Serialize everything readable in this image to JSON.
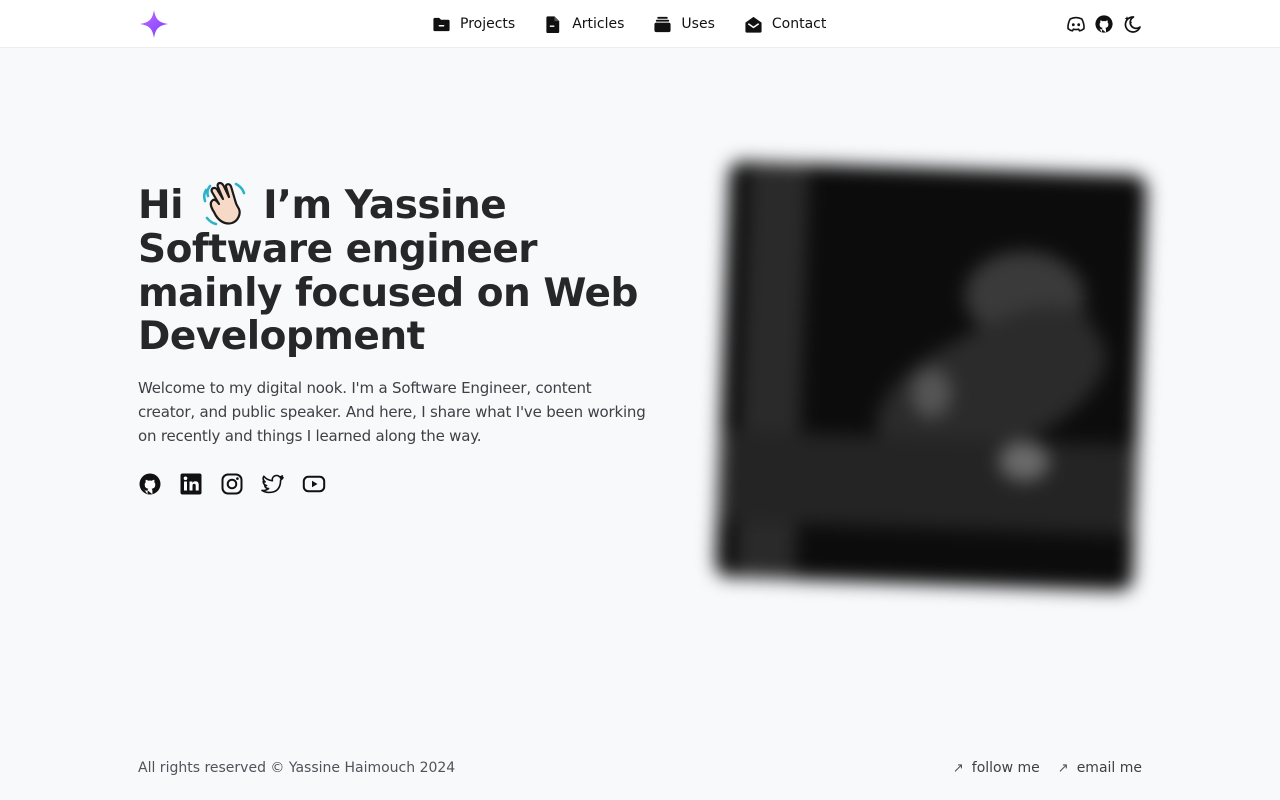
{
  "nav": {
    "items": [
      {
        "label": "Projects",
        "icon": "folder-icon"
      },
      {
        "label": "Articles",
        "icon": "file-icon"
      },
      {
        "label": "Uses",
        "icon": "layers-icon"
      },
      {
        "label": "Contact",
        "icon": "mail-open-icon"
      }
    ]
  },
  "header_icons": [
    "discord-icon",
    "github-icon",
    "theme-toggle-icon"
  ],
  "hero": {
    "title_parts": {
      "hi": "Hi",
      "line1_rest": "I’m Yassine",
      "line2": "Software engineer",
      "line3": "mainly focused on Web",
      "line4": "Development"
    },
    "intro": "Welcome to my digital nook. I'm a Software Engineer, content creator, and public speaker. And here, I share what I've been working on recently and things I learned along the way."
  },
  "socials": [
    "github-icon",
    "linkedin-icon",
    "instagram-icon",
    "twitter-icon",
    "youtube-icon"
  ],
  "footer": {
    "copyright": "All rights reserved © Yassine Haimouch 2024",
    "links": [
      {
        "label": "follow me"
      },
      {
        "label": "email me"
      }
    ]
  },
  "colors": {
    "accent": "#9b4dff",
    "background": "#f8f9fb",
    "text": "#27272a"
  }
}
